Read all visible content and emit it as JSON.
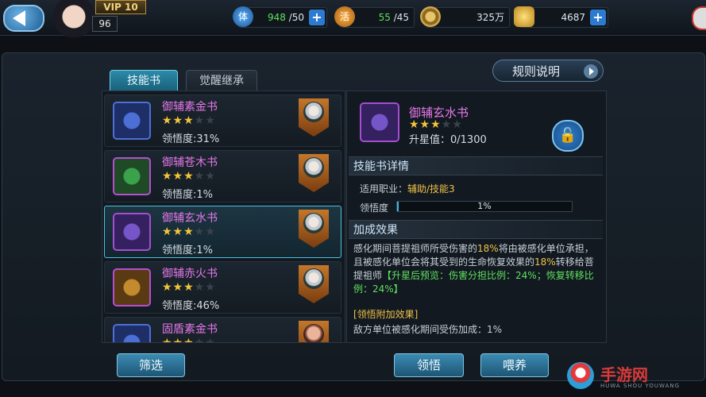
{
  "header": {
    "vip_label": "VIP 10",
    "player_level": "96",
    "stamina": {
      "icon": "lightning-icon",
      "icon_char": "体",
      "value": "948",
      "max": "/50"
    },
    "vitality": {
      "icon": "lightning-icon",
      "icon_char": "活",
      "value": "55",
      "max": "/45"
    },
    "coins": {
      "icon": "coin-icon",
      "value": "325万"
    },
    "ingots": {
      "icon": "gold-ingot-icon",
      "value": "4687"
    },
    "plus_label": "+"
  },
  "tabs": [
    {
      "label": "技能书",
      "active": true
    },
    {
      "label": "觉醒继承",
      "active": false
    }
  ],
  "rules_button": "规则说明",
  "book_list": [
    {
      "name": "御辅素金书",
      "stars_on": "★★★",
      "stars_off": "★★",
      "comprehension": "领悟度:31%",
      "badge": "character-portrait-icon"
    },
    {
      "name": "御辅苍木书",
      "stars_on": "★★★",
      "stars_off": "★★",
      "comprehension": "领悟度:1%",
      "badge": "character-portrait-icon"
    },
    {
      "name": "御辅玄水书",
      "stars_on": "★★★",
      "stars_off": "★★",
      "comprehension": "领悟度:1%",
      "badge": "character-portrait-icon",
      "selected": true
    },
    {
      "name": "御辅赤火书",
      "stars_on": "★★★",
      "stars_off": "★★",
      "comprehension": "领悟度:46%",
      "badge": "character-portrait-icon"
    },
    {
      "name": "固盾素金书",
      "stars_on": "★★★",
      "stars_off": "★★",
      "comprehension": "",
      "badge": "character-portrait-icon"
    }
  ],
  "detail": {
    "name": "御辅玄水书",
    "stars_on": "★★★",
    "stars_off": "★★",
    "star_value": "升星值：0/1300",
    "lock_icon": "unlock-icon",
    "section_detail": "技能书详情",
    "applicable_label": "适用职业：",
    "applicable_value": "辅助/技能3",
    "comprehension_label": "领悟度",
    "comprehension_value": "1%",
    "comprehension_fraction": 0.01,
    "section_bonus": "加成效果",
    "bonus_p1": "感化期间菩提祖师所受伤害的",
    "bonus_p1_hl1": "18%",
    "bonus_p2": "将由被感化单位承担，且被感化单位会将其受到的生命恢复效果的",
    "bonus_p2_hl2": "18%",
    "bonus_p3": "转移给菩提祖师",
    "bonus_p4": "【升星后预览：伤害分担比例：24%；恢复转移比例：24%】",
    "extra_head": "[领悟附加效果]",
    "extra_text": "敌方单位被感化期间受伤加成：1%"
  },
  "buttons": {
    "filter": "筛选",
    "comprehend": "领悟",
    "feed": "喂养"
  },
  "watermark": {
    "text": "手游网",
    "sub": "HUWA SHOU YOUWANG"
  }
}
